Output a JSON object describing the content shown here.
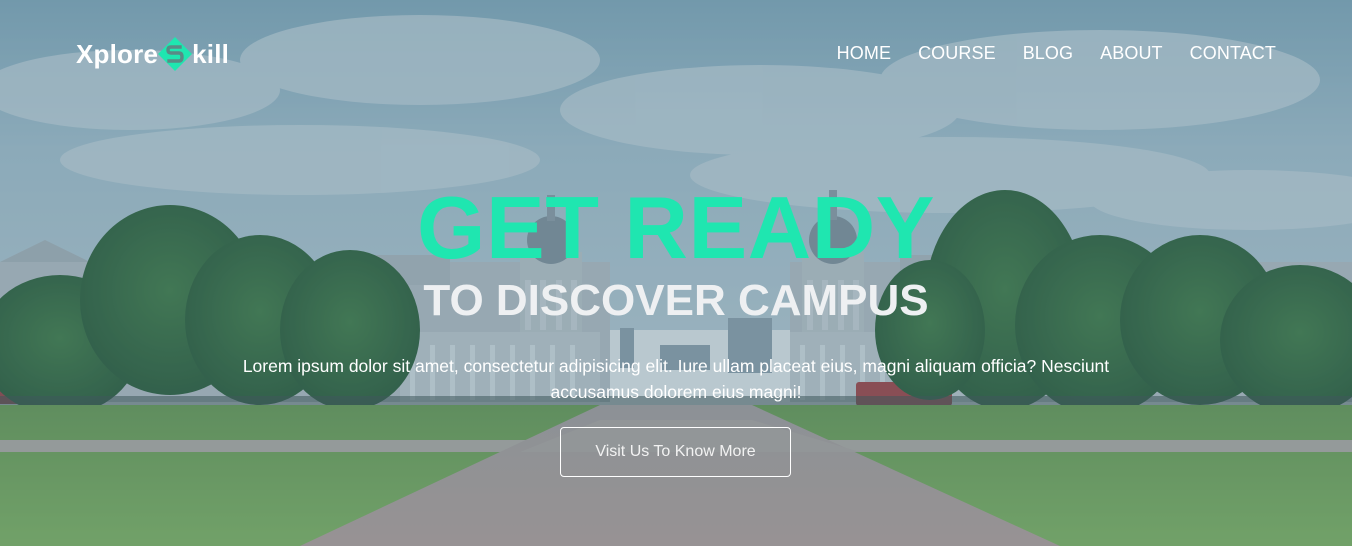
{
  "brand": {
    "name_prefix": "Xplore",
    "name_suffix": "kill",
    "logo_icon": "s-diamond-logo-icon",
    "accent_color": "#1fe6b0"
  },
  "nav": {
    "items": [
      {
        "label": "HOME"
      },
      {
        "label": "COURSE"
      },
      {
        "label": "BLOG"
      },
      {
        "label": "ABOUT"
      },
      {
        "label": "CONTACT"
      }
    ]
  },
  "hero": {
    "headline": "GET READY",
    "subheadline": "TO DISCOVER CAMPUS",
    "description": "Lorem ipsum dolor sit amet, consectetur adipisicing elit. Iure ullam placeat eius, magni aliquam officia? Nesciunt accusamus dolorem eius magni!",
    "cta_label": "Visit Us To Know More",
    "background": "campus-photo"
  }
}
